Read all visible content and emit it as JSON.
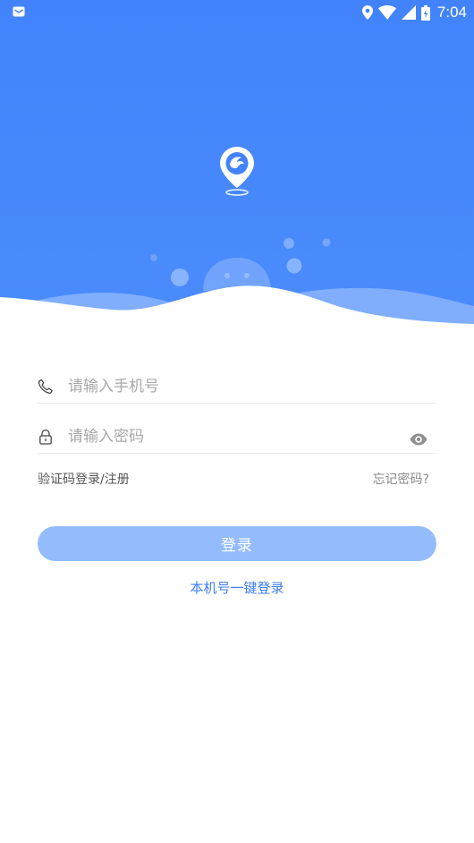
{
  "status_bar": {
    "time": "7:04"
  },
  "colors": {
    "header_blue": "#4283fb",
    "button_disabled": "#94bcfd",
    "link_blue": "#3f7ef0"
  },
  "form": {
    "phone_placeholder": "请输入手机号",
    "password_placeholder": "请输入密码",
    "sms_login_label": "验证码登录/注册",
    "forgot_password_label": "忘记密码?",
    "login_button_label": "登录",
    "one_click_login_label": "本机号一键登录"
  },
  "icons": {
    "status_left": "mail-icon",
    "location": "location-icon",
    "wifi": "wifi-icon",
    "signal": "signal-icon",
    "battery": "battery-icon",
    "logo": "map-pin-logo-icon",
    "phone": "phone-icon",
    "lock": "lock-icon",
    "eye": "eye-icon"
  }
}
